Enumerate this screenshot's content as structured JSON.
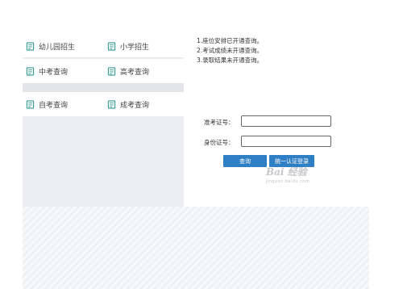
{
  "nav": {
    "items": [
      {
        "label": "幼儿园招生",
        "icon": "document-icon"
      },
      {
        "label": "小学招生",
        "icon": "document-icon"
      },
      {
        "label": "中考查询",
        "icon": "document-icon"
      },
      {
        "label": "高考查询",
        "icon": "document-icon"
      },
      {
        "label": "自考查询",
        "icon": "document-icon"
      },
      {
        "label": "成考查询",
        "icon": "document-icon"
      }
    ]
  },
  "notice": {
    "lines": [
      "1.座位安排已开通查询。",
      "2.考试成绩未开通查询。",
      "3.录取结果未开通查询。"
    ]
  },
  "form": {
    "exam_id_label": "准考证号：",
    "exam_id_value": "",
    "id_card_label": "身份证号：",
    "id_card_value": "",
    "query_button": "查询",
    "unified_login_button": "统一认证登录"
  },
  "watermark": {
    "logo": "Bai 经验",
    "url": "jingyan.baidu.com"
  },
  "colors": {
    "accent": "#2f7fc4",
    "icon": "#2e9a8f",
    "panel_bg": "#eceef1"
  }
}
